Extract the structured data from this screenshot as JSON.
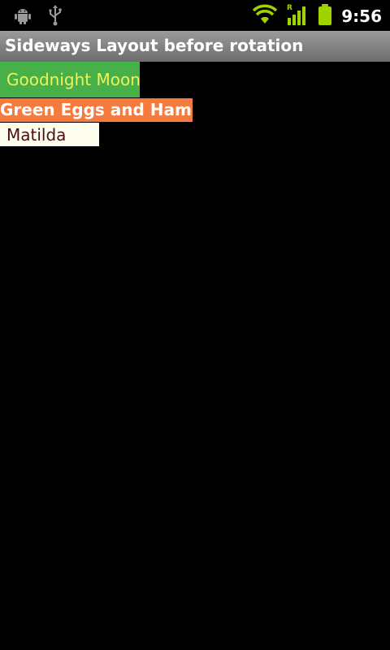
{
  "status_bar": {
    "time": "9:56",
    "icons": [
      "android-debug-icon",
      "usb-icon",
      "wifi-icon",
      "signal-roaming-icon",
      "battery-icon"
    ]
  },
  "app": {
    "title": "Sideways Layout before rotation"
  },
  "items": [
    {
      "label": "Goodnight Moon",
      "bg": "#48b048",
      "color": "#eef25e"
    },
    {
      "label": "Green Eggs and Ham",
      "bg": "#f57a3e",
      "color": "#ffffff"
    },
    {
      "label": "Matilda",
      "bg": "#fefeee",
      "color": "#4a1010"
    }
  ]
}
